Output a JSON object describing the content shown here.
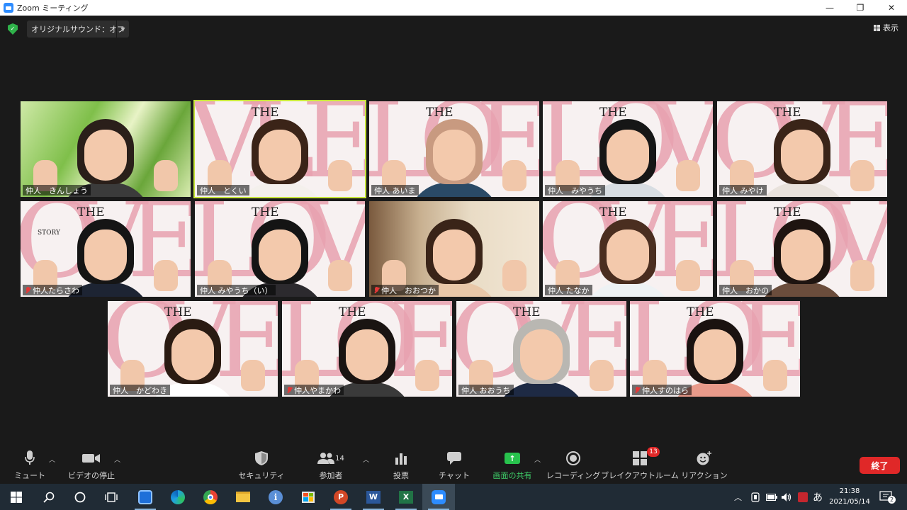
{
  "window": {
    "title": "Zoom ミーティング",
    "controls": {
      "minimize": "—",
      "maximize": "❐",
      "close": "✕"
    }
  },
  "topbar": {
    "sound_setting": "オリジナルサウンド：オフ",
    "view_label": "表示",
    "encryption_icon": "shield-check-icon"
  },
  "participants": [
    {
      "name": "仲人　きんしょう",
      "muted": false,
      "active": false,
      "background": "green-leaves",
      "hair": "#2a1f1a",
      "body": "#3b3b3b"
    },
    {
      "name": "仲人　とくい",
      "muted": false,
      "active": true,
      "background": "the-love-story",
      "hair": "#3b2418",
      "body": "#f4f0ec"
    },
    {
      "name": "仲人 あいま",
      "muted": false,
      "active": false,
      "background": "the-love-story",
      "hair": "#c89a80",
      "body": "#2a4a66"
    },
    {
      "name": "仲人　みやうち",
      "muted": false,
      "active": false,
      "background": "the-love-story",
      "hair": "#161616",
      "body": "#d8dde2"
    },
    {
      "name": "仲人 みやけ",
      "muted": false,
      "active": false,
      "background": "the-love-story",
      "hair": "#3a2418",
      "body": "#e9e2dc"
    },
    {
      "name": "仲人たらさわ",
      "muted": true,
      "active": false,
      "background": "the-love-story",
      "hair": "#151515",
      "body": "#1d2433"
    },
    {
      "name": "仲人 みやうち（い）",
      "muted": false,
      "active": false,
      "background": "the-love-story",
      "hair": "#141414",
      "body": "#2c2a2e"
    },
    {
      "name": "仲人　おおつか",
      "muted": true,
      "active": false,
      "background": "room",
      "hair": "#3a2418",
      "body": "#e8c7a8"
    },
    {
      "name": "仲人 たなか",
      "muted": false,
      "active": false,
      "background": "the-love-story",
      "hair": "#4a2e20",
      "body": "#eef2f4"
    },
    {
      "name": "仲人　おかの",
      "muted": false,
      "active": false,
      "background": "the-love-story",
      "hair": "#1e1410",
      "body": "#6b4d3c"
    },
    {
      "name": "仲人　かどわき",
      "muted": false,
      "active": false,
      "background": "the-love-story",
      "hair": "#2a1b12",
      "body": "#ffffff"
    },
    {
      "name": "仲人やまかわ",
      "muted": true,
      "active": false,
      "background": "the-love-story",
      "hair": "#1a1412",
      "body": "#3a3a3a"
    },
    {
      "name": "仲人 おおうち",
      "muted": false,
      "active": false,
      "background": "the-love-story",
      "hair": "#b9b7b2",
      "body": "#1e2a44"
    },
    {
      "name": "仲人すのはら",
      "muted": true,
      "active": false,
      "background": "the-love-story",
      "hair": "#1a1210",
      "body": "#e89a8a"
    }
  ],
  "background_text": {
    "the": "THE",
    "story": "STORY"
  },
  "toolbar": {
    "mute": "ミュート",
    "stop_video": "ビデオの停止",
    "security": "セキュリティ",
    "participants": "参加者",
    "participants_count": "14",
    "poll": "投票",
    "chat": "チャット",
    "share_screen": "画面の共有",
    "recording": "レコーディング",
    "breakout": "ブレイクアウトルーム",
    "breakout_badge": "13",
    "reactions": "リアクション",
    "end": "終了"
  },
  "colors": {
    "accent_green": "#28c24d",
    "end_red": "#e02828",
    "active_outline": "#c6e53a",
    "love_pink": "#e8a2b0"
  },
  "taskbar": {
    "time": "21:38",
    "date": "2021/05/14",
    "ime": "あ",
    "notification_count": "2",
    "apps": [
      "windows-start-icon",
      "search-icon",
      "cortana-icon",
      "task-view-icon",
      "clipboard-app-icon",
      "edge-icon",
      "chrome-icon",
      "file-explorer-icon",
      "info-icon",
      "store-icon",
      "powerpoint-icon",
      "word-icon",
      "excel-icon",
      "zoom-icon"
    ]
  }
}
